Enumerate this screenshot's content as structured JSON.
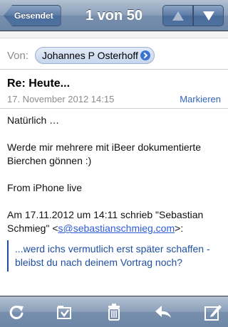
{
  "navbar": {
    "back_label": "Gesendet",
    "title": "1 von 50",
    "prev_icon": "triangle-up-icon",
    "next_icon": "triangle-down-icon"
  },
  "header": {
    "from_label": "Von:",
    "from_name": "Johannes P Osterhoff",
    "subject": "Re: Heute...",
    "date": "17. November 2012 14:15",
    "mark_label": "Markieren"
  },
  "body": {
    "line1": "Natürlich …",
    "line2": "Werde mir mehrere mit iBeer dokumentierte Bierchen gönnen :)",
    "line3": "From iPhone live",
    "quote_intro_pre": "Am 17.11.2012 um 14:11 schrieb \"Sebastian Schmieg\" <",
    "quote_email": "s@sebastianschmieg.com",
    "quote_intro_post": ">:",
    "quoted_text": "...werd ichs vermutlich erst später schaffen - bleibst du nach deinem Vortrag noch?"
  },
  "toolbar": {
    "items": [
      {
        "icon": "refresh-icon"
      },
      {
        "icon": "move-to-folder-icon"
      },
      {
        "icon": "trash-icon"
      },
      {
        "icon": "reply-icon"
      },
      {
        "icon": "compose-icon"
      }
    ]
  },
  "colors": {
    "bar_blue": "#7890ad",
    "link_blue": "#3366bb",
    "quote_blue": "#1f4fa0"
  }
}
